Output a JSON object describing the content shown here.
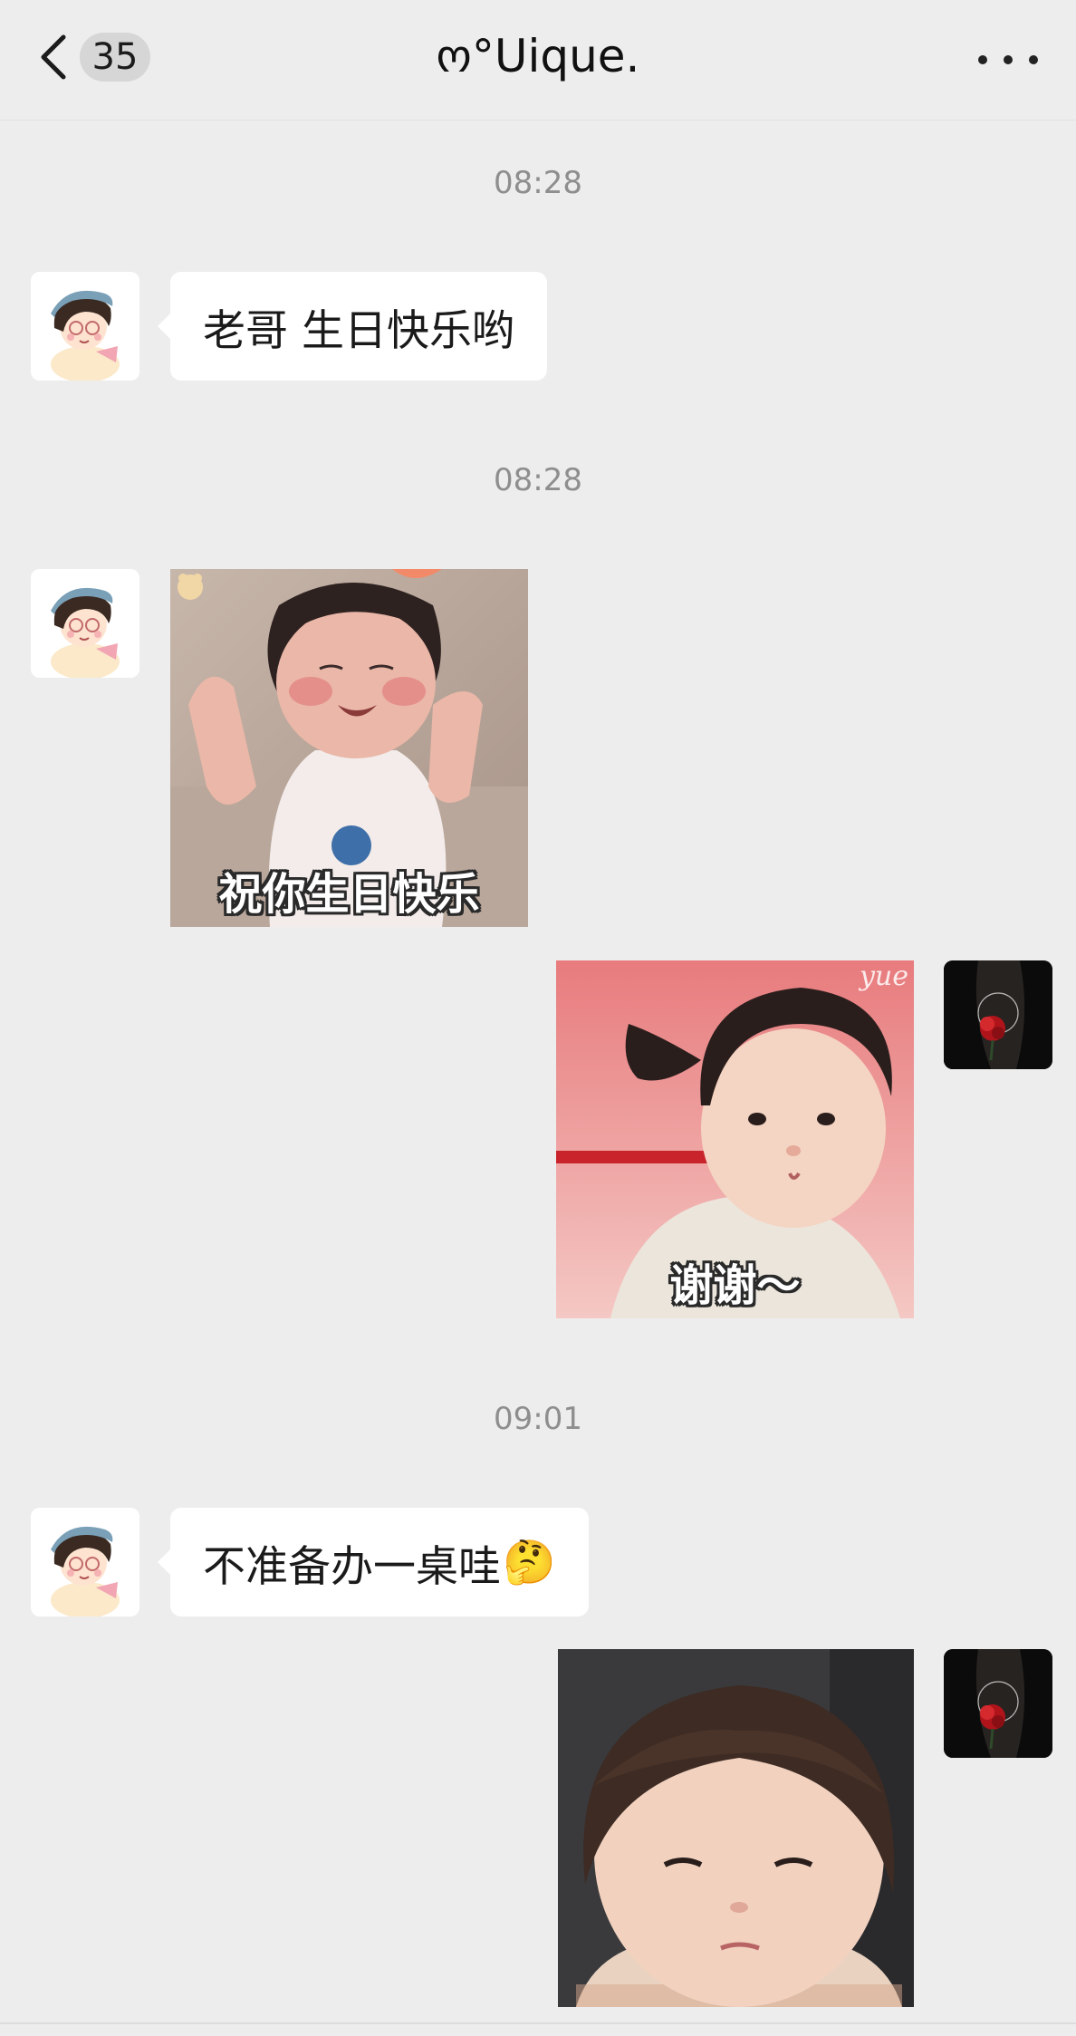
{
  "header": {
    "unread_count": "35",
    "title": "ო°Uique.",
    "icons": {
      "back": "chevron-left-icon",
      "more": "more-dots-icon"
    }
  },
  "messages": {
    "time_1": "08:28",
    "msg_1_text": "老哥 生日快乐哟",
    "time_2": "08:28",
    "sticker_1_caption": "祝你生日快乐",
    "sticker_2_caption": "谢谢～",
    "sticker_2_watermark": "yue",
    "time_3": "09:01",
    "msg_2_text": "不准备办一桌哇",
    "msg_2_emoji": "🤔"
  },
  "colors": {
    "background": "#ededed",
    "bubble": "#ffffff",
    "timestamp": "#8e8e8e"
  }
}
